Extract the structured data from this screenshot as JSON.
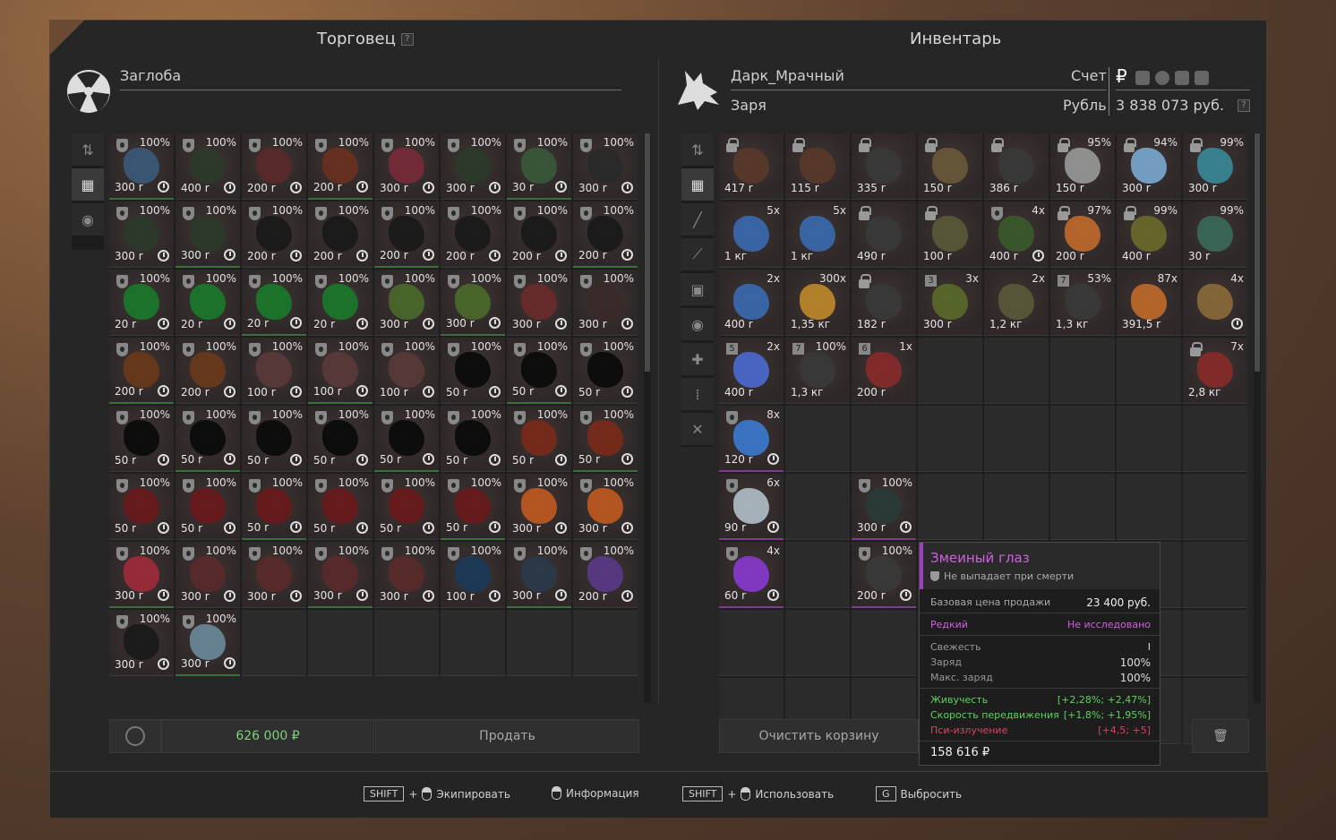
{
  "trader": {
    "title": "Торговец",
    "q": "?",
    "name": "Заглоба"
  },
  "inventory": {
    "title": "Инвентарь",
    "player": "Дарк_Мрачный",
    "faction": "Заря",
    "account_label": "Счет",
    "currency_label": "Рубль",
    "balance": "3 838 073 руб.",
    "currency_symbol": "₽",
    "q": "?"
  },
  "trader_items": [
    [
      "100%",
      "300 r",
      "#3a5a7a"
    ],
    [
      "100%",
      "400 r",
      "#2a3a2a"
    ],
    [
      "100%",
      "200 r",
      "#5a2a2a"
    ],
    [
      "100%",
      "200 r",
      "#6a3020"
    ],
    [
      "100%",
      "300 r",
      "#7a2a3a"
    ],
    [
      "100%",
      "300 r",
      "#2a3a2a"
    ],
    [
      "100%",
      "30 r",
      "#3a5a3a"
    ],
    [
      "100%",
      "300 r",
      "#2a2a2a"
    ],
    [
      "100%",
      "300 r",
      "#2a3a2a"
    ],
    [
      "100%",
      "300 r",
      "#2a3a2a"
    ],
    [
      "100%",
      "200 r",
      "#1a1a1a"
    ],
    [
      "100%",
      "200 r",
      "#1a1a1a"
    ],
    [
      "100%",
      "200 r",
      "#1a1a1a"
    ],
    [
      "100%",
      "200 r",
      "#1a1a1a"
    ],
    [
      "100%",
      "200 r",
      "#1a1a1a"
    ],
    [
      "100%",
      "200 r",
      "#1a1a1a"
    ],
    [
      "100%",
      "20 r",
      "#1a7a2a"
    ],
    [
      "100%",
      "20 r",
      "#1a7a2a"
    ],
    [
      "100%",
      "20 r",
      "#1a7a2a"
    ],
    [
      "100%",
      "20 r",
      "#1a7a2a"
    ],
    [
      "100%",
      "300 r",
      "#4a6a2a"
    ],
    [
      "100%",
      "300 r",
      "#4a6a2a"
    ],
    [
      "100%",
      "300 r",
      "#6a2a2a"
    ],
    [
      "100%",
      "300 r",
      "#3a2a2a"
    ],
    [
      "100%",
      "200 r",
      "#6a3a1a"
    ],
    [
      "100%",
      "200 r",
      "#6a3a1a"
    ],
    [
      "100%",
      "100 r",
      "#5a3a3a"
    ],
    [
      "100%",
      "100 r",
      "#5a3a3a"
    ],
    [
      "100%",
      "100 r",
      "#5a3a3a"
    ],
    [
      "100%",
      "50 r",
      "#0a0a0a"
    ],
    [
      "100%",
      "50 r",
      "#0a0a0a"
    ],
    [
      "100%",
      "50 r",
      "#0a0a0a"
    ],
    [
      "100%",
      "50 r",
      "#0a0a0a"
    ],
    [
      "100%",
      "50 r",
      "#0a0a0a"
    ],
    [
      "100%",
      "50 r",
      "#0a0a0a"
    ],
    [
      "100%",
      "50 r",
      "#0a0a0a"
    ],
    [
      "100%",
      "50 r",
      "#0a0a0a"
    ],
    [
      "100%",
      "50 r",
      "#0a0a0a"
    ],
    [
      "100%",
      "50 r",
      "#7a2a1a"
    ],
    [
      "100%",
      "50 r",
      "#7a2a1a"
    ],
    [
      "100%",
      "50 r",
      "#6a1a1a"
    ],
    [
      "100%",
      "50 r",
      "#6a1a1a"
    ],
    [
      "100%",
      "50 r",
      "#6a1a1a"
    ],
    [
      "100%",
      "50 r",
      "#6a1a1a"
    ],
    [
      "100%",
      "50 r",
      "#6a1a1a"
    ],
    [
      "100%",
      "50 r",
      "#6a1a1a"
    ],
    [
      "100%",
      "300 r",
      "#c05a20"
    ],
    [
      "100%",
      "300 r",
      "#c05a20"
    ],
    [
      "100%",
      "300 r",
      "#a02a3a"
    ],
    [
      "100%",
      "300 r",
      "#5a2a2a"
    ],
    [
      "100%",
      "300 r",
      "#5a2a2a"
    ],
    [
      "100%",
      "300 r",
      "#5a2a2a"
    ],
    [
      "100%",
      "300 r",
      "#5a2a2a"
    ],
    [
      "100%",
      "100 r",
      "#1a3a5a"
    ],
    [
      "100%",
      "300 r",
      "#2a3a4a"
    ],
    [
      "100%",
      "200 r",
      "#5a3a8a"
    ],
    [
      "100%",
      "300 r",
      "#1a1a1a"
    ],
    [
      "100%",
      "300 r",
      "#6a8a9a"
    ]
  ],
  "inv_items": [
    {
      "c": 1,
      "r": 1,
      "t": "lock",
      "pr": "417 r",
      "col": "#5a3a2a"
    },
    {
      "c": 2,
      "r": 1,
      "t": "lock",
      "pr": "115 r",
      "col": "#5a3a2a"
    },
    {
      "c": 3,
      "r": 1,
      "t": "lock",
      "pr": "335 r",
      "col": "#3a3a3a"
    },
    {
      "c": 4,
      "r": 1,
      "t": "lock",
      "pr": "150 r",
      "col": "#6a5a3a"
    },
    {
      "c": 5,
      "r": 1,
      "t": "lock",
      "pr": "386 r",
      "col": "#3a3a3a"
    },
    {
      "c": 6,
      "r": 1,
      "t": "lock",
      "badge": "95%",
      "pr": "150 r",
      "col": "#9a9a9a"
    },
    {
      "c": 7,
      "r": 1,
      "t": "lock",
      "badge": "94%",
      "pr": "300 r",
      "col": "#7aaad0"
    },
    {
      "c": 8,
      "r": 1,
      "t": "lock",
      "badge": "99%",
      "pr": "300 r",
      "col": "#3a8a9a"
    },
    {
      "c": 1,
      "r": 2,
      "t": "",
      "badge": "5x",
      "pr": "1 кг",
      "col": "#3a6ab0"
    },
    {
      "c": 2,
      "r": 2,
      "t": "",
      "badge": "5x",
      "pr": "1 кг",
      "col": "#3a6ab0"
    },
    {
      "c": 3,
      "r": 2,
      "t": "lock",
      "pr": "490 r",
      "col": "#3a3a3a"
    },
    {
      "c": 4,
      "r": 2,
      "t": "lock",
      "pr": "100 r",
      "col": "#5a5a3a"
    },
    {
      "c": 5,
      "r": 2,
      "t": "shield",
      "badge": "4x",
      "pr": "400 r",
      "col": "#3a5a2a"
    },
    {
      "c": 6,
      "r": 2,
      "t": "lock",
      "badge": "97%",
      "pr": "200 r",
      "col": "#c06a2a"
    },
    {
      "c": 7,
      "r": 2,
      "t": "lock",
      "badge": "99%",
      "pr": "400 r",
      "col": "#6a6a2a"
    },
    {
      "c": 8,
      "r": 2,
      "t": "",
      "badge": "99%",
      "pr": "30 r",
      "col": "#3a6a5a"
    },
    {
      "c": 1,
      "r": 3,
      "t": "",
      "badge": "2x",
      "pr": "400 r",
      "col": "#3a6ab0"
    },
    {
      "c": 2,
      "r": 3,
      "t": "",
      "badge": "300x",
      "pr": "1,35 кг",
      "col": "#c08a2a"
    },
    {
      "c": 3,
      "r": 3,
      "t": "lock",
      "pr": "182 r",
      "col": "#3a3a3a"
    },
    {
      "c": 4,
      "r": 3,
      "t": "num",
      "n": "3",
      "badge": "3x",
      "pr": "300 r",
      "col": "#5a6a2a"
    },
    {
      "c": 5,
      "r": 3,
      "t": "",
      "badge": "2x",
      "pr": "1,2 кг",
      "col": "#5a5a3a"
    },
    {
      "c": 6,
      "r": 3,
      "t": "num",
      "n": "7",
      "badge": "53%",
      "pr": "1,3 кг",
      "col": "#3a3a3a"
    },
    {
      "c": 7,
      "r": 3,
      "t": "",
      "badge": "87x",
      "pr": "391,5 r",
      "col": "#c06a2a"
    },
    {
      "c": 8,
      "r": 3,
      "t": "",
      "badge": "4x",
      "pr": "",
      "col": "#8a6a3a"
    },
    {
      "c": 1,
      "r": 4,
      "t": "num",
      "n": "5",
      "badge": "2x",
      "pr": "400 r",
      "col": "#4a6ad0"
    },
    {
      "c": 2,
      "r": 4,
      "t": "num",
      "n": "7",
      "badge": "100%",
      "pr": "1,3 кг",
      "col": "#3a3a3a"
    },
    {
      "c": 3,
      "r": 4,
      "t": "num",
      "n": "6",
      "badge": "1x",
      "pr": "200 r",
      "col": "#8a2a2a"
    },
    {
      "c": 8,
      "r": 4,
      "t": "lock",
      "badge": "7x",
      "pr": "2,8 кг",
      "col": "#8a2a2a"
    },
    {
      "c": 1,
      "r": 5,
      "t": "shield",
      "badge": "8x",
      "pr": "120 r",
      "col": "#3a7ad0"
    },
    {
      "c": 1,
      "r": 6,
      "t": "shield",
      "badge": "6x",
      "pr": "90 r",
      "col": "#b0c0c8"
    },
    {
      "c": 3,
      "r": 6,
      "t": "shield",
      "badge": "100%",
      "pr": "300 r",
      "col": "#2a3a3a"
    },
    {
      "c": 1,
      "r": 7,
      "t": "shield",
      "badge": "4x",
      "pr": "60 r",
      "col": "#8a3ad0"
    },
    {
      "c": 3,
      "r": 7,
      "t": "shield",
      "badge": "100%",
      "pr": "200 r",
      "col": "#3a3a3a"
    }
  ],
  "bottom": {
    "sum": "626 000 ₽",
    "sell": "Продать",
    "clear": "Очистить корзину"
  },
  "tooltip": {
    "name": "Змеиный глаз",
    "sub": "Не выпадает при смерти",
    "base_label": "Базовая цена продажи",
    "base_val": "23 400 руб.",
    "rarity": "Редкий",
    "research": "Не исследовано",
    "fresh": "Свежесть",
    "fresh_val": "I",
    "charge": "Заряд",
    "charge_val": "100%",
    "maxc": "Макс. заряд",
    "maxc_val": "100%",
    "s1": "Живучесть",
    "s1v": "[+2,28%; +2,47%]",
    "s2": "Скорость передвижения",
    "s2v": "[+1,8%; +1,95%]",
    "s3": "Пси-излучение",
    "s3v": "[+4,5; +5]",
    "price": "158 616 ₽"
  },
  "footer": {
    "shift": "SHIFT",
    "plus": "+",
    "equip": "Экипировать",
    "info": "Информация",
    "use": "Использовать",
    "g": "G",
    "drop": "Выбросить"
  }
}
